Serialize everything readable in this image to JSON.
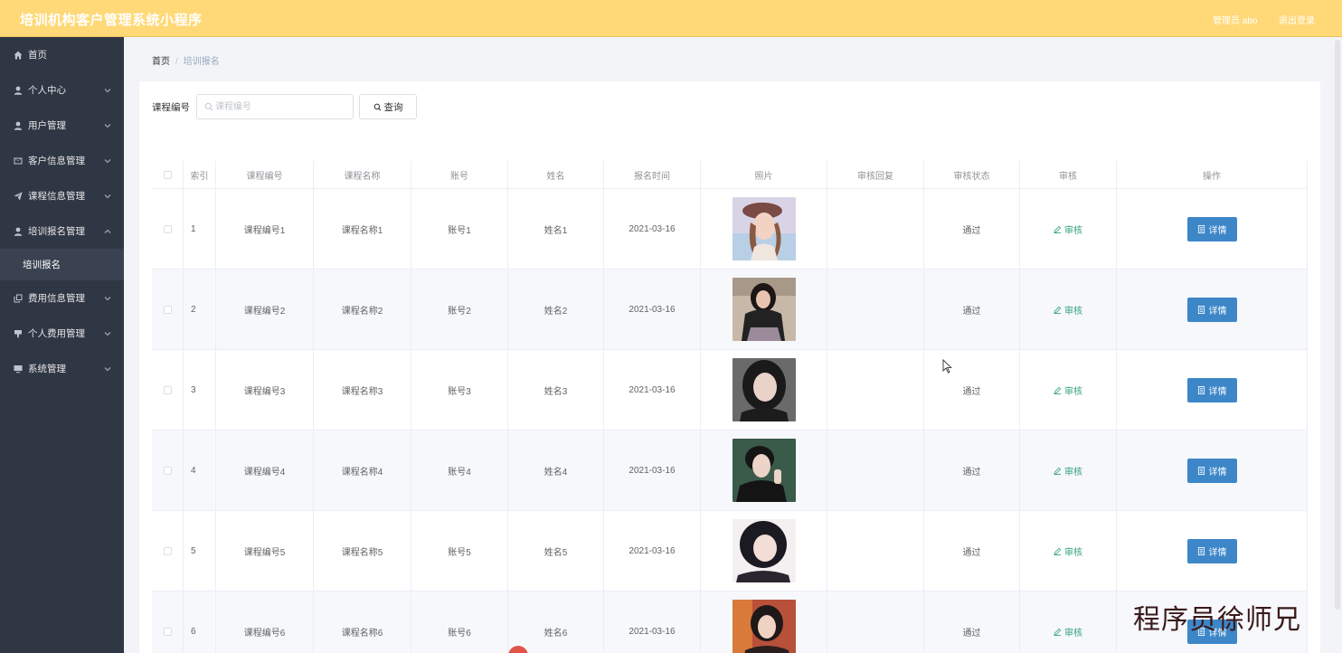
{
  "header": {
    "title": "培训机构客户管理系统小程序",
    "user": "管理员 abo",
    "logout": "退出登录"
  },
  "sidebar": {
    "items": [
      {
        "label": "首页",
        "icon": "home-icon",
        "has_arrow": false
      },
      {
        "label": "个人中心",
        "icon": "user-icon",
        "has_arrow": true
      },
      {
        "label": "用户管理",
        "icon": "user-icon",
        "has_arrow": true
      },
      {
        "label": "客户信息管理",
        "icon": "mail-icon",
        "has_arrow": true
      },
      {
        "label": "课程信息管理",
        "icon": "send-icon",
        "has_arrow": true
      },
      {
        "label": "培训报名管理",
        "icon": "user-icon",
        "has_arrow": true,
        "expanded": true
      },
      {
        "label": "费用信息管理",
        "icon": "copy-icon",
        "has_arrow": true
      },
      {
        "label": "个人费用管理",
        "icon": "thumb-icon",
        "has_arrow": true
      },
      {
        "label": "系统管理",
        "icon": "monitor-icon",
        "has_arrow": true
      }
    ],
    "submenu": {
      "label": "培训报名"
    }
  },
  "breadcrumb": {
    "home": "首页",
    "separator": "/",
    "current": "培训报名"
  },
  "search": {
    "label": "课程编号",
    "placeholder": "课程编号",
    "value": "",
    "button": "查询"
  },
  "table": {
    "headers": [
      "",
      "索引",
      "课程编号",
      "课程名称",
      "账号",
      "姓名",
      "报名时间",
      "照片",
      "审核回复",
      "审核状态",
      "审核",
      "操作"
    ],
    "rows": [
      {
        "index": "1",
        "course_no": "课程编号1",
        "course_name": "课程名称1",
        "account": "账号1",
        "name": "姓名1",
        "time": "2021-03-16",
        "reply": "",
        "status": "通过",
        "audit": "审核",
        "action": "详情"
      },
      {
        "index": "2",
        "course_no": "课程编号2",
        "course_name": "课程名称2",
        "account": "账号2",
        "name": "姓名2",
        "time": "2021-03-16",
        "reply": "",
        "status": "通过",
        "audit": "审核",
        "action": "详情"
      },
      {
        "index": "3",
        "course_no": "课程编号3",
        "course_name": "课程名称3",
        "account": "账号3",
        "name": "姓名3",
        "time": "2021-03-16",
        "reply": "",
        "status": "通过",
        "audit": "审核",
        "action": "详情"
      },
      {
        "index": "4",
        "course_no": "课程编号4",
        "course_name": "课程名称4",
        "account": "账号4",
        "name": "姓名4",
        "time": "2021-03-16",
        "reply": "",
        "status": "通过",
        "audit": "审核",
        "action": "详情"
      },
      {
        "index": "5",
        "course_no": "课程编号5",
        "course_name": "课程名称5",
        "account": "账号5",
        "name": "姓名5",
        "time": "2021-03-16",
        "reply": "",
        "status": "通过",
        "audit": "审核",
        "action": "详情"
      },
      {
        "index": "6",
        "course_no": "课程编号6",
        "course_name": "课程名称6",
        "account": "账号6",
        "name": "姓名6",
        "time": "2021-03-16",
        "reply": "",
        "status": "通过",
        "audit": "审核",
        "action": "详情"
      }
    ]
  },
  "watermark": "程序员徐师兄",
  "colors": {
    "header_bg": "#ffd978",
    "sidebar_bg": "#2f3644",
    "primary_button": "#3d87c9",
    "audit_link": "#34a37a"
  }
}
